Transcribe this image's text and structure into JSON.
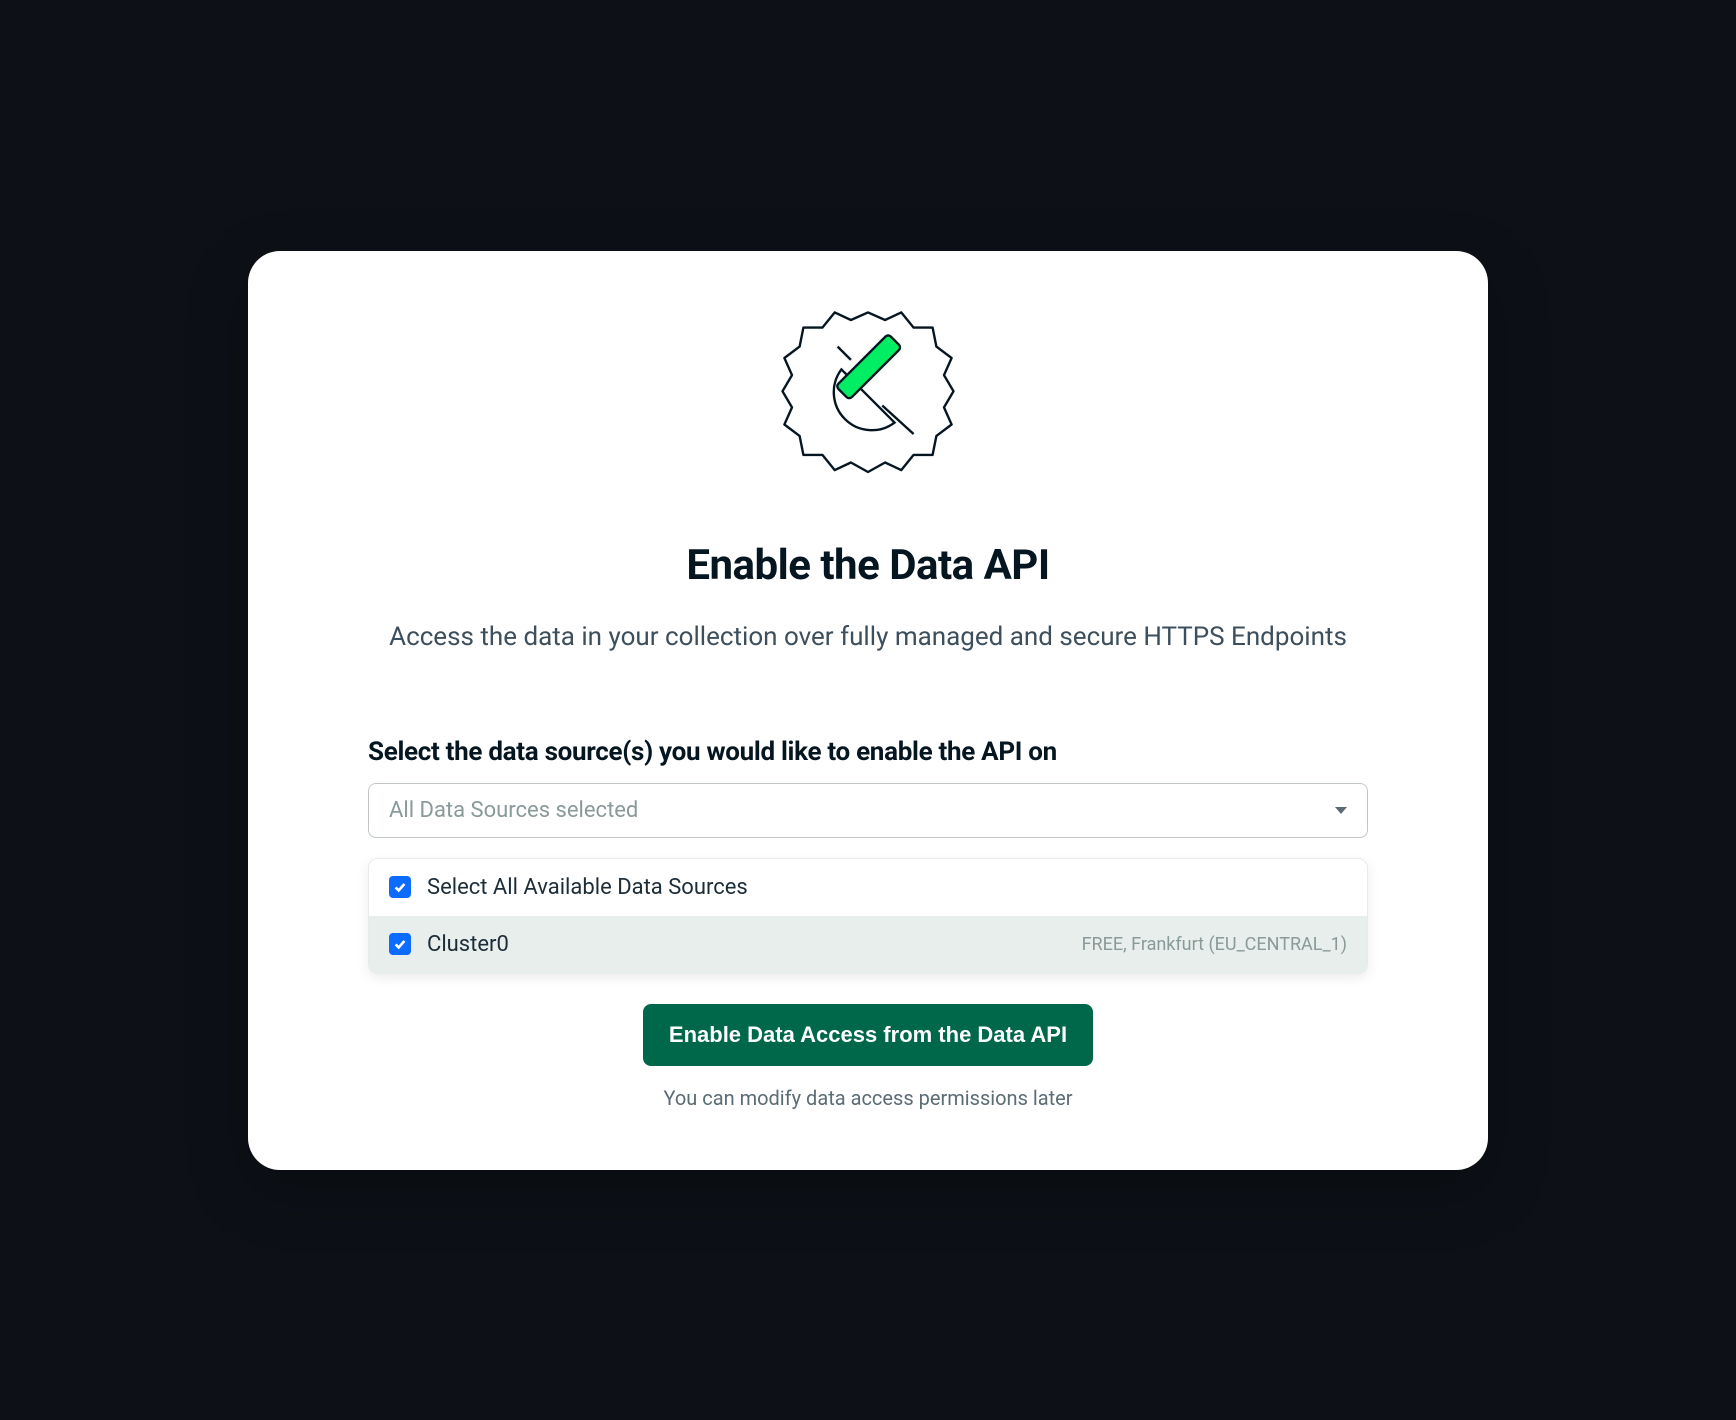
{
  "modal": {
    "title": "Enable the Data API",
    "subtitle": "Access the data in your collection over fully managed and secure HTTPS Endpoints",
    "section_label": "Select the data source(s) you would like to enable the API on",
    "dropdown": {
      "selected_text": "All Data Sources selected"
    },
    "options": {
      "select_all": {
        "label": "Select All Available Data Sources",
        "checked": true
      },
      "cluster": {
        "label": "Cluster0",
        "meta": "FREE, Frankfurt (EU_CENTRAL_1)",
        "checked": true
      }
    },
    "primary_button": "Enable Data Access from the Data API",
    "helper_text": "You can modify data access permissions later"
  },
  "colors": {
    "accent_green": "#00ed64",
    "button_green": "#00684a",
    "checkbox_blue": "#0b6cff",
    "text_dark": "#061621",
    "text_muted": "#5c6c75"
  },
  "icons": {
    "hero": "gear-plug-icon",
    "dropdown": "caret-down-icon",
    "checkbox": "checkmark-icon"
  }
}
